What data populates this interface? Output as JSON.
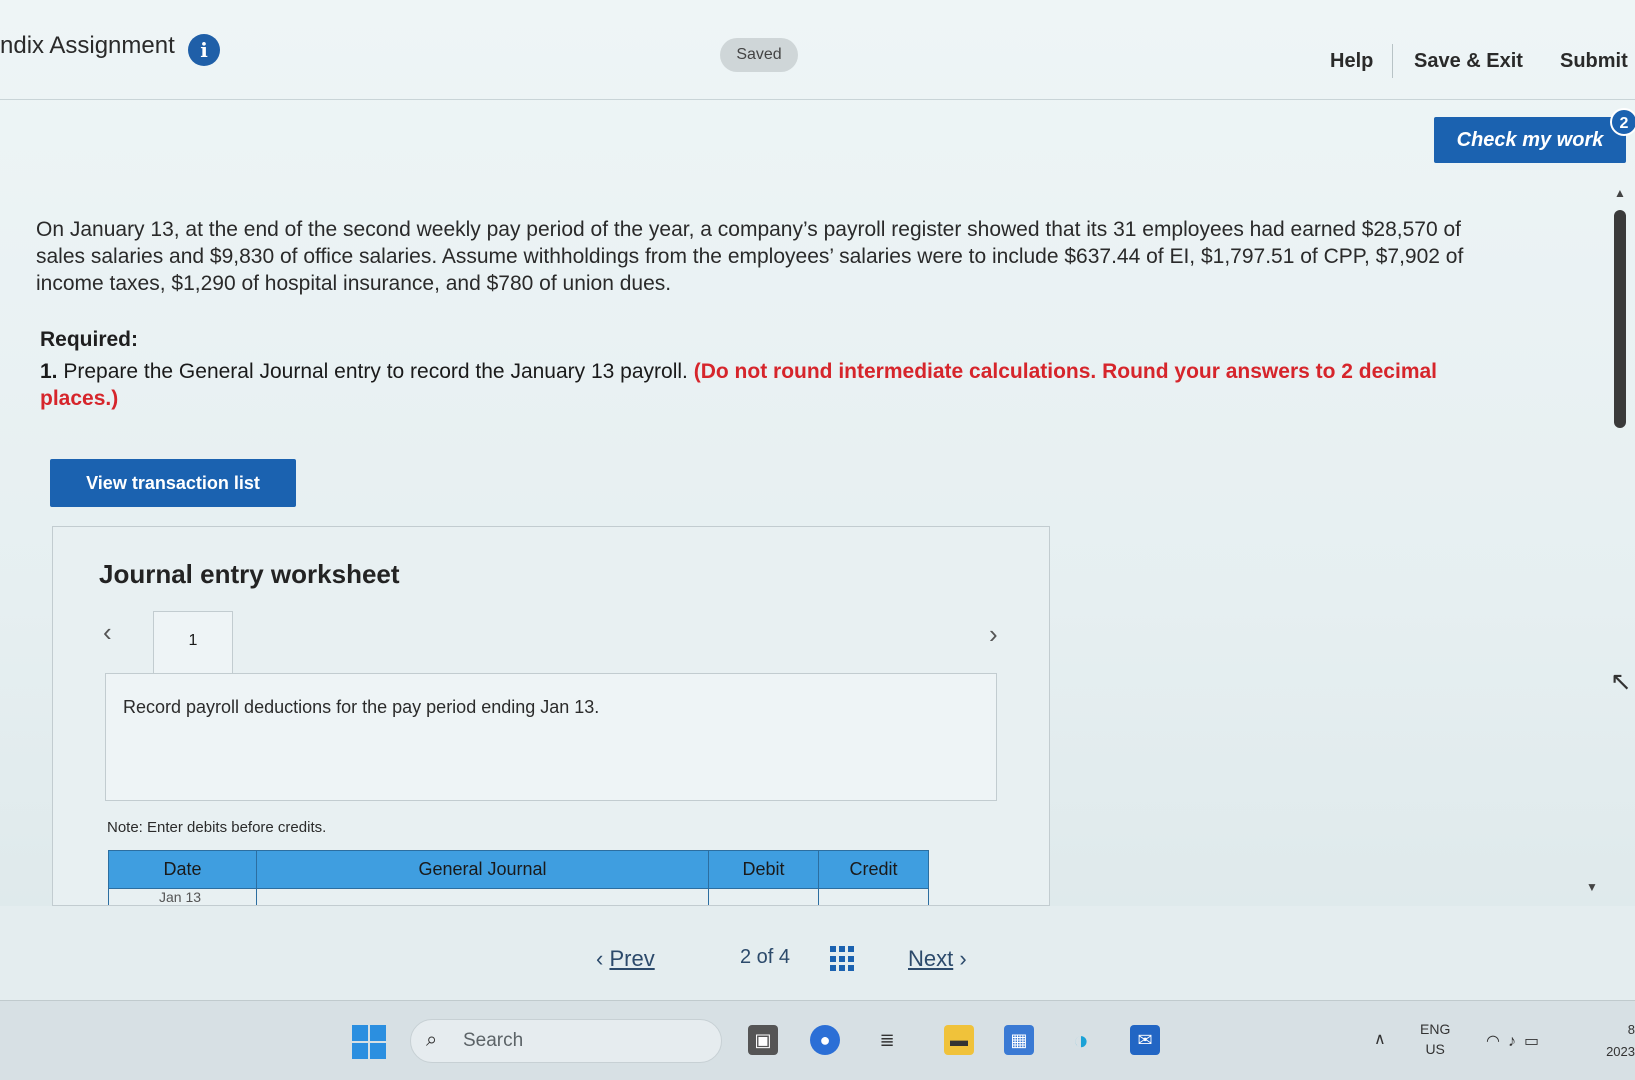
{
  "header": {
    "title": "ndix Assignment",
    "saved_label": "Saved",
    "help_label": "Help",
    "save_exit_label": "Save & Exit",
    "submit_label": "Submit",
    "check_label": "Check my work",
    "check_badge": "2"
  },
  "question": {
    "text": "On January 13, at the end of the second weekly pay period of the year, a company’s payroll register showed that its 31 employees had earned $28,570 of sales salaries and $9,830 of office salaries. Assume withholdings from the employees’ salaries were to include $637.44 of EI, $1,797.51 of CPP, $7,902 of income taxes, $1,290 of hospital insurance, and $780 of union dues.",
    "required_heading": "Required:",
    "req_num": "1.",
    "req_text": "Prepare the General Journal entry to record the January 13 payroll.",
    "req_instruction": "(Do not round intermediate calculations. Round your answers to 2 decimal places.)"
  },
  "view_transaction_label": "View transaction list",
  "worksheet": {
    "title": "Journal entry worksheet",
    "tab_number": "1",
    "description": "Record payroll deductions for the pay period ending Jan 13.",
    "note": "Note: Enter debits before credits.",
    "columns": [
      "Date",
      "General Journal",
      "Debit",
      "Credit"
    ],
    "first_row_date": "Jan 13"
  },
  "navigation": {
    "prev_label": "Prev",
    "page_indicator": "2 of 4",
    "next_label": "Next"
  },
  "taskbar": {
    "search_placeholder": "Search",
    "lang_line1": "ENG",
    "lang_line2": "US",
    "clock_line1": "8",
    "clock_line2": "2023"
  },
  "colors": {
    "primary_button": "#1b62b0",
    "instruction_red": "#d6252b",
    "table_header": "#3f9ee0"
  }
}
